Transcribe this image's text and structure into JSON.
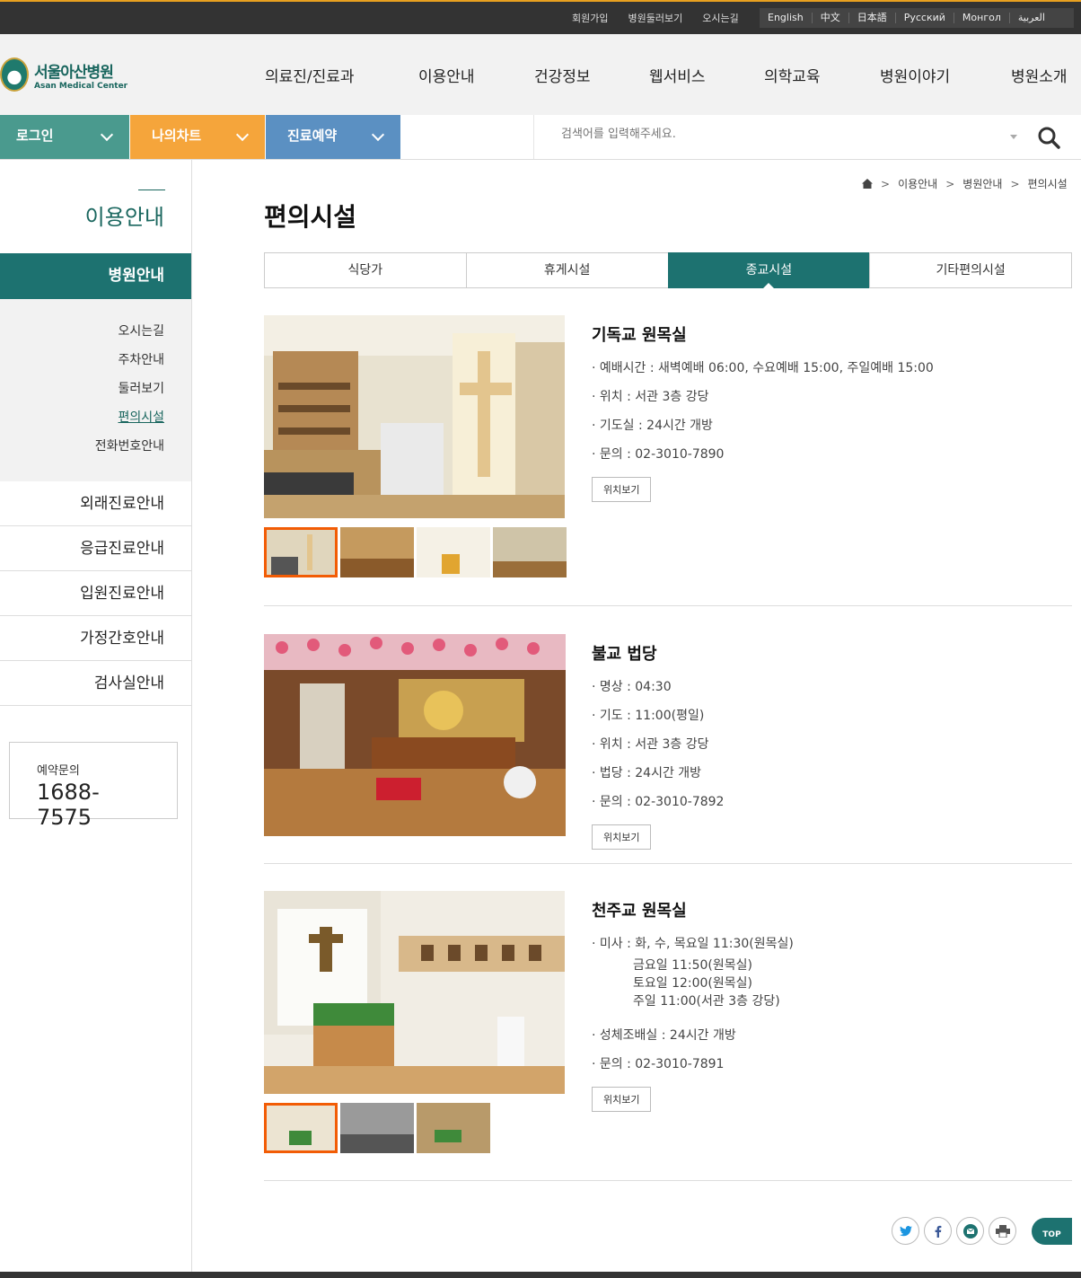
{
  "util": {
    "links": [
      "회원가입",
      "병원둘러보기",
      "오시는길"
    ],
    "langs": [
      "English",
      "中文",
      "日本語",
      "Русский",
      "Монгол",
      "العربية"
    ]
  },
  "header": {
    "logo_ko": "서울아산병원",
    "logo_en": "Asan Medical Center",
    "gnb": [
      "의료진/진료과",
      "이용안내",
      "건강정보",
      "웹서비스",
      "의학교육",
      "병원이야기",
      "병원소개"
    ]
  },
  "quick": {
    "login": "로그인",
    "chart": "나의차트",
    "resv": "진료예약",
    "search_placeholder": "검색어를 입력해주세요."
  },
  "sidebar": {
    "title": "이용안내",
    "active": "병원안내",
    "sub": [
      "오시는길",
      "주차안내",
      "둘러보기",
      "편의시설",
      "전화번호안내"
    ],
    "menu": [
      "외래진료안내",
      "응급진료안내",
      "입원진료안내",
      "가정간호안내",
      "검사실안내"
    ],
    "contact_label": "예약문의",
    "contact_num": "1688-7575"
  },
  "breadcrumb": [
    "이용안내",
    "병원안내",
    "편의시설"
  ],
  "page_title": "편의시설",
  "tabs": [
    "식당가",
    "휴게시설",
    "종교시설",
    "기타편의시설"
  ],
  "facilities": [
    {
      "title": "기독교 원목실",
      "lines": [
        "· 예배시간 : 새벽예배 06:00, 수요예배 15:00, 주일예배 15:00",
        "· 위치 : 서관 3층 강당",
        "· 기도실 : 24시간 개방",
        "· 문의 : 02-3010-7890"
      ],
      "btn": "위치보기"
    },
    {
      "title": "불교 법당",
      "lines": [
        "· 명상 : 04:30",
        "· 기도 : 11:00(평일)",
        "· 위치 : 서관 3층 강당",
        "· 법당 : 24시간 개방",
        "· 문의 : 02-3010-7892"
      ],
      "btn": "위치보기"
    },
    {
      "title": "천주교 원목실",
      "mass": "· 미사 : 화, 수, 목요일 11:30(원목실)",
      "mass_cont": [
        "금요일 11:50(원목실)",
        "토요일 12:00(원목실)",
        "주일 11:00(서관 3층 강당)"
      ],
      "lines": [
        "· 성체조배실 : 24시간 개방",
        "· 문의 : 02-3010-7891"
      ],
      "btn": "위치보기"
    }
  ],
  "top_label": "TOP"
}
